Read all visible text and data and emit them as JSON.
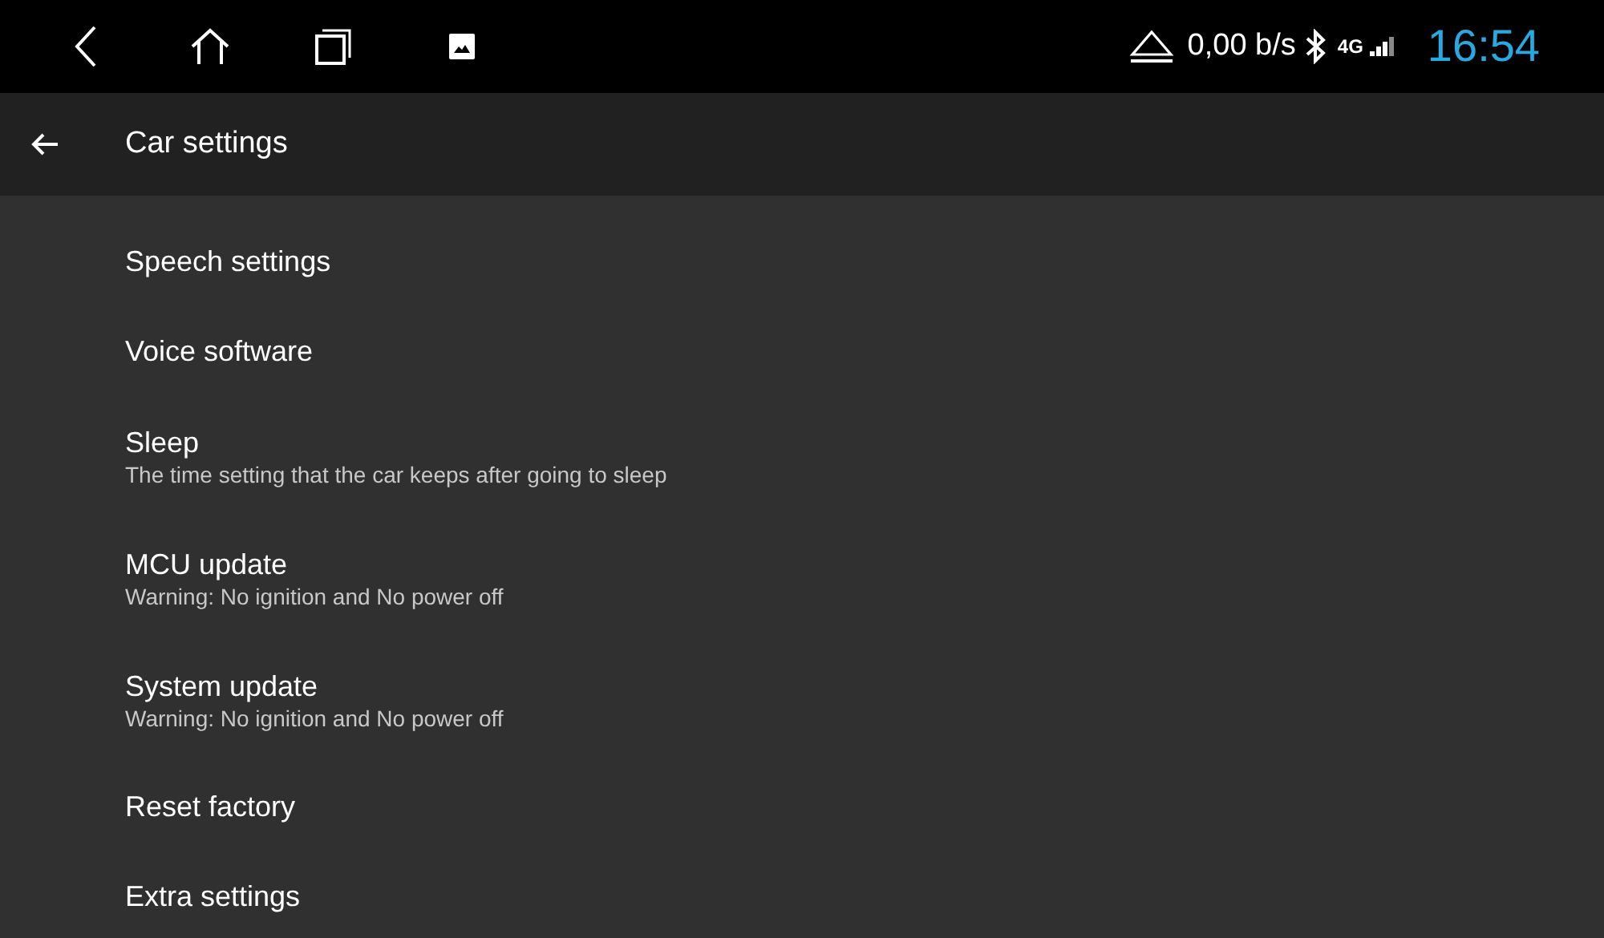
{
  "status_bar": {
    "speed": "0,00 b/s",
    "network": "4G",
    "time": "16:54"
  },
  "app_bar": {
    "title": "Car settings"
  },
  "items": [
    {
      "title": "Speech settings"
    },
    {
      "title": "Voice software"
    },
    {
      "title": "Sleep",
      "subtitle": "The time setting that the car keeps after going to sleep"
    },
    {
      "title": "MCU update",
      "subtitle": "Warning: No ignition and No power off"
    },
    {
      "title": "System update",
      "subtitle": "Warning: No ignition and No power off"
    },
    {
      "title": "Reset factory"
    },
    {
      "title": "Extra settings"
    }
  ]
}
